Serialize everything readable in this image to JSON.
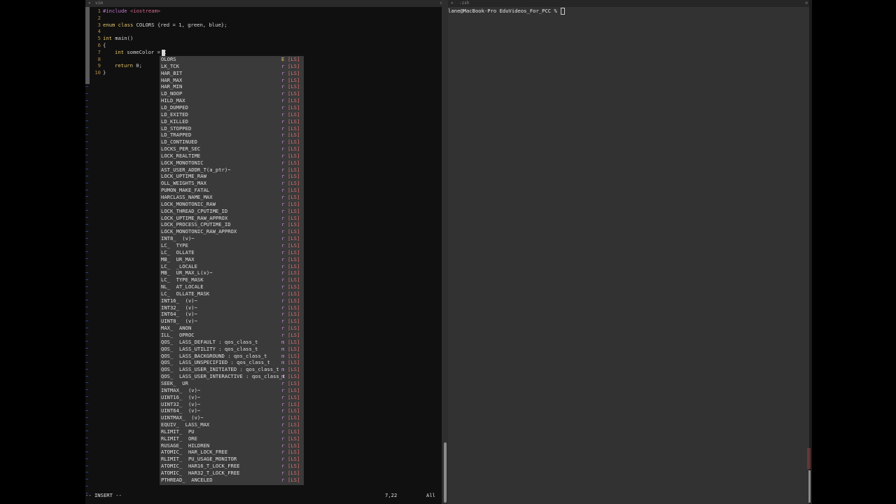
{
  "vim": {
    "window_title": "vim",
    "line_numbers": [
      "1",
      "2",
      "3",
      "4",
      "5",
      "6",
      "7",
      "8",
      "9",
      "10"
    ],
    "lines": {
      "l1_a": "#include ",
      "l1_b": "<iostream>",
      "l3_kw1": "enum",
      "l3_kw2": "class",
      "l3_rest": " COLORS {red = 1, green, blue};",
      "l5_kw": "int",
      "l5_rest": " main()",
      "l6": "{",
      "l7_kw": "int",
      "l7_rest": " someColor = C",
      "l9_kw": "return",
      "l9_rest": " 0;",
      "l10": "}"
    },
    "tilde": "~",
    "status": {
      "mode": "-- INSERT --",
      "position": "7,22",
      "scroll": "All"
    }
  },
  "popup": {
    "items": [
      {
        "label": "OLORS",
        "kind": "E",
        "src": "[LS]"
      },
      {
        "label": "LK_TCK",
        "kind": "r",
        "src": "[LS]"
      },
      {
        "label": "HAR_BIT",
        "kind": "r",
        "src": "[LS]"
      },
      {
        "label": "HAR_MAX",
        "kind": "r",
        "src": "[LS]"
      },
      {
        "label": "HAR_MIN",
        "kind": "r",
        "src": "[LS]"
      },
      {
        "label": "LD_NOOP",
        "kind": "r",
        "src": "[LS]"
      },
      {
        "label": "HILD_MAX",
        "kind": "r",
        "src": "[LS]"
      },
      {
        "label": "LD_DUMPED",
        "kind": "r",
        "src": "[LS]"
      },
      {
        "label": "LD_EXITED",
        "kind": "r",
        "src": "[LS]"
      },
      {
        "label": "LD_KILLED",
        "kind": "r",
        "src": "[LS]"
      },
      {
        "label": "LD_STOPPED",
        "kind": "r",
        "src": "[LS]"
      },
      {
        "label": "LD_TRAPPED",
        "kind": "r",
        "src": "[LS]"
      },
      {
        "label": "LD_CONTINUED",
        "kind": "r",
        "src": "[LS]"
      },
      {
        "label": "LOCKS_PER_SEC",
        "kind": "r",
        "src": "[LS]"
      },
      {
        "label": "LOCK_REALTIME",
        "kind": "r",
        "src": "[LS]"
      },
      {
        "label": "LOCK_MONOTONIC",
        "kind": "r",
        "src": "[LS]"
      },
      {
        "label": "AST_USER_ADDR_T(a_ptr)~",
        "kind": "r",
        "src": "[LS]"
      },
      {
        "label": "LOCK_UPTIME_RAW",
        "kind": "r",
        "src": "[LS]"
      },
      {
        "label": "OLL_WEIGHTS_MAX",
        "kind": "r",
        "src": "[LS]"
      },
      {
        "label": "PUMON_MAKE_FATAL",
        "kind": "r",
        "src": "[LS]"
      },
      {
        "label": "HARCLASS_NAME_MAX",
        "kind": "r",
        "src": "[LS]"
      },
      {
        "label": "LOCK_MONOTONIC_RAW",
        "kind": "r",
        "src": "[LS]"
      },
      {
        "label": "LOCK_THREAD_CPUTIME_ID",
        "kind": "r",
        "src": "[LS]"
      },
      {
        "label": "LOCK_UPTIME_RAW_APPROX",
        "kind": "r",
        "src": "[LS]"
      },
      {
        "label": "LOCK_PROCESS_CPUTIME_ID",
        "kind": "r",
        "src": "[LS]"
      },
      {
        "label": "LOCK_MONOTONIC_RAW_APPROX",
        "kind": "r",
        "src": "[LS]"
      },
      {
        "label": "INT8_  (v)~",
        "kind": "r",
        "src": "[LS]"
      },
      {
        "label": "LC_  TYPE",
        "kind": "r",
        "src": "[LS]"
      },
      {
        "label": "LC_  OLLATE",
        "kind": "r",
        "src": "[LS]"
      },
      {
        "label": "MB_  UR_MAX",
        "kind": "r",
        "src": "[LS]"
      },
      {
        "label": "LC_  _LOCALE",
        "kind": "r",
        "src": "[LS]"
      },
      {
        "label": "MB_  UR_MAX_L(x)~",
        "kind": "r",
        "src": "[LS]"
      },
      {
        "label": "LC_  TYPE_MASK",
        "kind": "r",
        "src": "[LS]"
      },
      {
        "label": "NL_  AT_LOCALE",
        "kind": "r",
        "src": "[LS]"
      },
      {
        "label": "LC_  OLLATE_MASK",
        "kind": "r",
        "src": "[LS]"
      },
      {
        "label": "INT16_  (v)~",
        "kind": "r",
        "src": "[LS]"
      },
      {
        "label": "INT32_  (v)~",
        "kind": "r",
        "src": "[LS]"
      },
      {
        "label": "INT64_  (v)~",
        "kind": "r",
        "src": "[LS]"
      },
      {
        "label": "UINT8_  (v)~",
        "kind": "r",
        "src": "[LS]"
      },
      {
        "label": "MAX_  ANON",
        "kind": "r",
        "src": "[LS]"
      },
      {
        "label": "ILL_  OPROC",
        "kind": "r",
        "src": "[LS]"
      },
      {
        "label": "QOS_  LASS_DEFAULT : qos_class_t",
        "kind": "m",
        "src": "[LS]"
      },
      {
        "label": "QOS_  LASS_UTILITY : qos_class_t",
        "kind": "m",
        "src": "[LS]"
      },
      {
        "label": "QOS_  LASS_BACKGROUND : qos_class_t",
        "kind": "m",
        "src": "[LS]"
      },
      {
        "label": "QOS_  LASS_UNSPECIFIED : qos_class_t",
        "kind": "m",
        "src": "[LS]"
      },
      {
        "label": "QOS_  LASS_USER_INITIATED : qos_class_t",
        "kind": "m",
        "src": "[LS]"
      },
      {
        "label": "QOS_  LASS_USER_INTERACTIVE : qos_class_t",
        "kind": "m",
        "src": "[LS]"
      },
      {
        "label": "SEEK_  UR",
        "kind": "r",
        "src": "[LS]"
      },
      {
        "label": "INTMAX_  (v)~",
        "kind": "r",
        "src": "[LS]"
      },
      {
        "label": "UINT16_  (v)~",
        "kind": "r",
        "src": "[LS]"
      },
      {
        "label": "UINT32_  (v)~",
        "kind": "r",
        "src": "[LS]"
      },
      {
        "label": "UINT64_  (v)~",
        "kind": "r",
        "src": "[LS]"
      },
      {
        "label": "UINTMAX_  (v)~",
        "kind": "r",
        "src": "[LS]"
      },
      {
        "label": "EQUIV_  LASS_MAX",
        "kind": "r",
        "src": "[LS]"
      },
      {
        "label": "RLIMIT_  PU",
        "kind": "r",
        "src": "[LS]"
      },
      {
        "label": "RLIMIT_  ORE",
        "kind": "r",
        "src": "[LS]"
      },
      {
        "label": "RUSAGE_  HILDREN",
        "kind": "r",
        "src": "[LS]"
      },
      {
        "label": "ATOMIC_  HAR_LOCK_FREE",
        "kind": "r",
        "src": "[LS]"
      },
      {
        "label": "RLIMIT_  PU_USAGE_MONITOR",
        "kind": "r",
        "src": "[LS]"
      },
      {
        "label": "ATOMIC_  HAR16_T_LOCK_FREE",
        "kind": "r",
        "src": "[LS]"
      },
      {
        "label": "ATOMIC_  HAR32_T_LOCK_FREE",
        "kind": "r",
        "src": "[LS]"
      },
      {
        "label": "PTHREAD_  ANCELED",
        "kind": "r",
        "src": "[LS]"
      }
    ]
  },
  "terminal": {
    "window_title": "-zsh",
    "prompt": "lane@MacBook-Pro EduVideos_For_PCC %"
  },
  "colors": {
    "tilde": "#3c5bd6",
    "keyword": "#e3c56b",
    "kind_marker": "#c78ad8",
    "source_marker": "#e07070"
  }
}
